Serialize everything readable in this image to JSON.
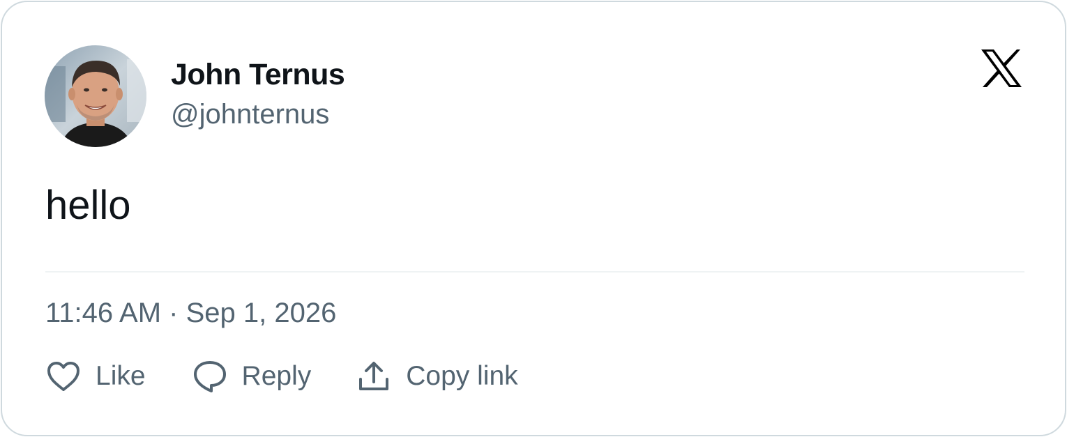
{
  "author": {
    "name": "John Ternus",
    "handle": "@johnternus",
    "avatar_icon": "user-avatar-photo"
  },
  "brand": {
    "logo_icon": "x-logo-icon"
  },
  "tweet": {
    "text": "hello",
    "timestamp": "11:46 AM · Sep 1, 2026"
  },
  "actions": {
    "like_label": "Like",
    "reply_label": "Reply",
    "copy_link_label": "Copy link"
  },
  "colors": {
    "text_primary": "#0f1419",
    "text_secondary": "#536471",
    "border": "#cfd9de",
    "divider": "#eff3f4"
  }
}
